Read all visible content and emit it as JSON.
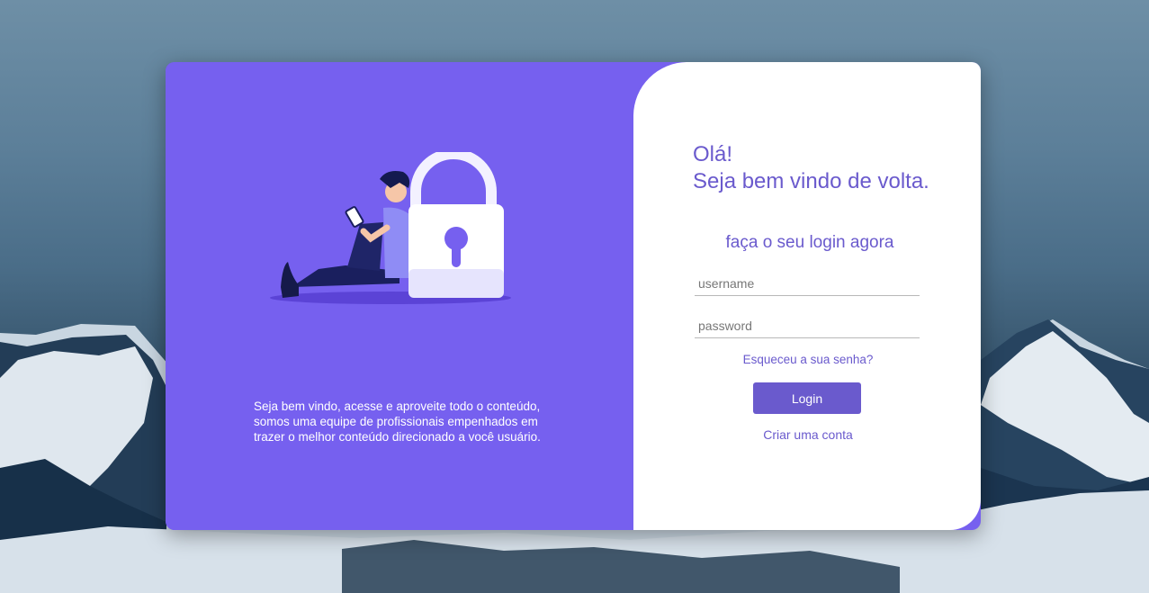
{
  "left": {
    "description": "Seja bem vindo, acesse e aproveite todo o conteúdo, somos uma equipe de profissionais empenhados em trazer o melhor conteúdo direcionado a você usuário."
  },
  "right": {
    "greeting_line1": "Olá!",
    "greeting_line2": "Seja bem vindo de volta.",
    "subtitle": "faça o seu login agora",
    "username_placeholder": "username",
    "password_placeholder": "password",
    "forgot_link": "Esqueceu a sua senha?",
    "login_button": "Login",
    "create_account_link": "Criar uma conta"
  },
  "colors": {
    "accent": "#6a5acd",
    "left_panel": "#7660ef"
  }
}
